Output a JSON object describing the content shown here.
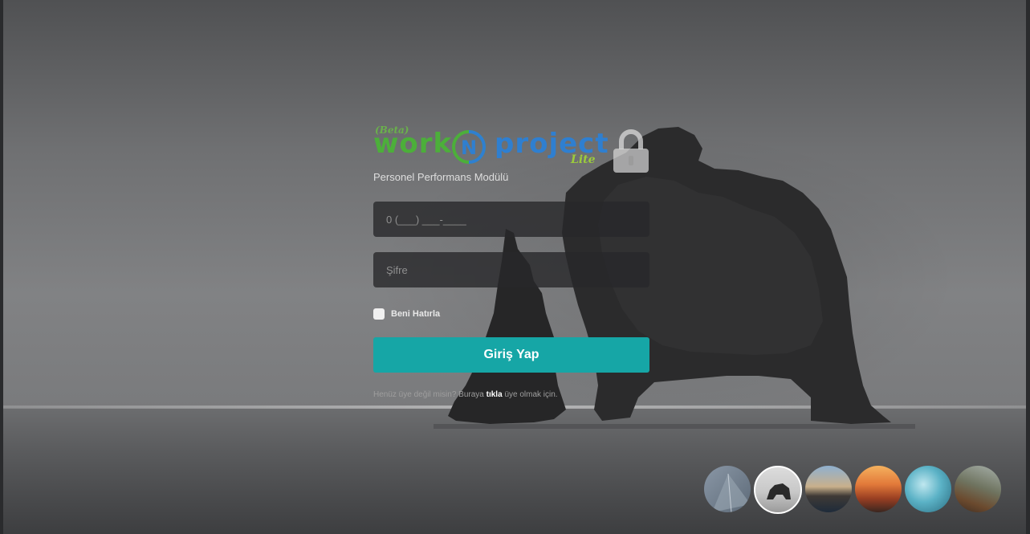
{
  "logo": {
    "beta": "(Beta)",
    "work": "work",
    "project": "project",
    "lite": "Lite",
    "n_letter": "N"
  },
  "login": {
    "subtitle": "Personel Performans Modülü",
    "phone_placeholder": "0 (___) ___-____",
    "password_placeholder": "Şifre",
    "remember_label": "Beni Hatırla",
    "submit_label": "Giriş Yap",
    "register_prefix": "Henüz üye değil misin? Buraya",
    "register_link": "tıkla",
    "register_suffix": "üye olmak için."
  },
  "icons": {
    "lock": "lock-icon"
  },
  "colors": {
    "accent": "#16a6a6",
    "logo_green": "#4caf3a",
    "logo_blue": "#2f7fd0",
    "lite_green": "#9ccc3c"
  },
  "backgrounds": {
    "selected_index": 1,
    "count": 6
  }
}
